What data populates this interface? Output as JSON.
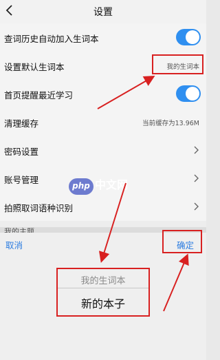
{
  "header": {
    "title": "设置",
    "back_icon": "chevron-left-icon"
  },
  "rows": [
    {
      "label": "查词历史自动加入生词本",
      "toggle": true
    },
    {
      "label": "设置默认生词本",
      "value": "我的生词本"
    },
    {
      "label": "首页提醒最近学习",
      "toggle": true
    },
    {
      "label": "清理缓存",
      "value": "当前缓存为13.96M"
    },
    {
      "label": "密码设置",
      "chevron": true
    },
    {
      "label": "账号管理",
      "chevron": true
    },
    {
      "label": "拍照取词语种识别",
      "chevron": true
    },
    {
      "label": "我的主题"
    }
  ],
  "watermark": {
    "logo": "php",
    "text": "中文网"
  },
  "picker": {
    "cancel_label": "取消",
    "confirm_label": "确定",
    "options": [
      "我的生词本",
      "新的本子"
    ]
  },
  "colors": {
    "accent": "#2f8ff0",
    "link": "#2d7de0",
    "annotation": "#d82020"
  }
}
